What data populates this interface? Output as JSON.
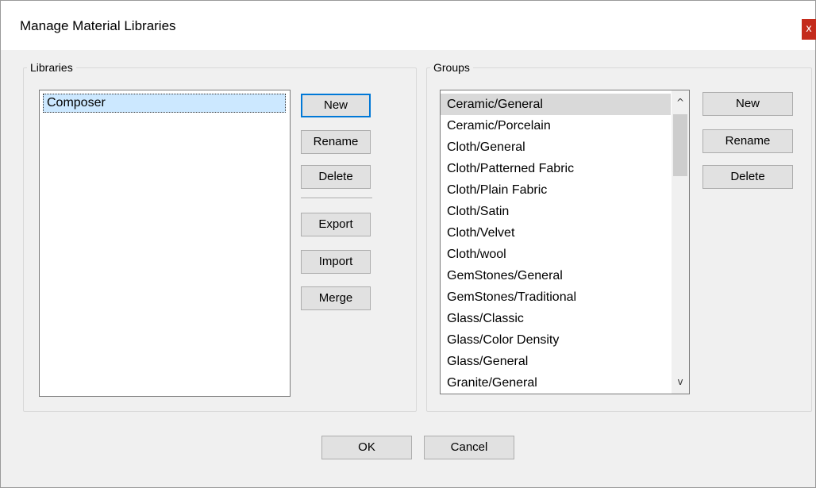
{
  "window": {
    "title": "Manage Material Libraries",
    "close_glyph": "x"
  },
  "libraries": {
    "legend": "Libraries",
    "items": [
      "Composer"
    ],
    "buttons": {
      "new": "New",
      "rename": "Rename",
      "delete": "Delete",
      "export": "Export",
      "import": "Import",
      "merge": "Merge"
    }
  },
  "groups": {
    "legend": "Groups",
    "items": [
      "Ceramic/General",
      "Ceramic/Porcelain",
      "Cloth/General",
      "Cloth/Patterned Fabric",
      "Cloth/Plain Fabric",
      "Cloth/Satin",
      "Cloth/Velvet",
      "Cloth/wool",
      "GemStones/General",
      "GemStones/Traditional",
      "Glass/Classic",
      "Glass/Color Density",
      "Glass/General",
      "Granite/General"
    ],
    "selected_index": 0,
    "scroll": {
      "up_glyph": "^",
      "down_glyph": "v"
    },
    "buttons": {
      "new": "New",
      "rename": "Rename",
      "delete": "Delete"
    }
  },
  "footer": {
    "ok": "OK",
    "cancel": "Cancel"
  },
  "colors": {
    "close_red": "#c42b1c",
    "selection_blue": "#cce8ff",
    "default_button_border": "#0078d7"
  }
}
